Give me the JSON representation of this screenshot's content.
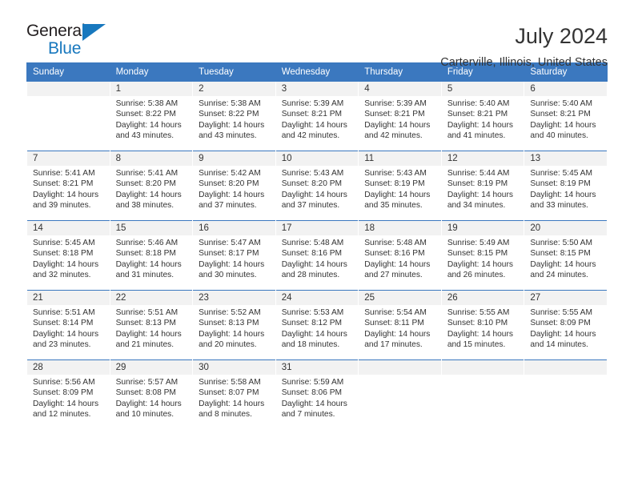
{
  "brand": {
    "name_part1": "General",
    "name_part2": "Blue"
  },
  "header": {
    "title": "July 2024",
    "location": "Carterville, Illinois, United States"
  },
  "weekdays": [
    "Sunday",
    "Monday",
    "Tuesday",
    "Wednesday",
    "Thursday",
    "Friday",
    "Saturday"
  ],
  "colors": {
    "header_blue": "#3b78bf",
    "brand_blue": "#1878be",
    "daynum_bg": "#f2f2f2",
    "text": "#333333"
  },
  "labels": {
    "sunrise_prefix": "Sunrise: ",
    "sunset_prefix": "Sunset: ",
    "daylight_prefix": "Daylight: "
  },
  "weeks": [
    [
      {
        "day": "",
        "sunrise": "",
        "sunset": "",
        "daylight_l1": "",
        "daylight_l2": "",
        "empty": true
      },
      {
        "day": "1",
        "sunrise": "Sunrise: 5:38 AM",
        "sunset": "Sunset: 8:22 PM",
        "daylight_l1": "Daylight: 14 hours",
        "daylight_l2": "and 43 minutes."
      },
      {
        "day": "2",
        "sunrise": "Sunrise: 5:38 AM",
        "sunset": "Sunset: 8:22 PM",
        "daylight_l1": "Daylight: 14 hours",
        "daylight_l2": "and 43 minutes."
      },
      {
        "day": "3",
        "sunrise": "Sunrise: 5:39 AM",
        "sunset": "Sunset: 8:21 PM",
        "daylight_l1": "Daylight: 14 hours",
        "daylight_l2": "and 42 minutes."
      },
      {
        "day": "4",
        "sunrise": "Sunrise: 5:39 AM",
        "sunset": "Sunset: 8:21 PM",
        "daylight_l1": "Daylight: 14 hours",
        "daylight_l2": "and 42 minutes."
      },
      {
        "day": "5",
        "sunrise": "Sunrise: 5:40 AM",
        "sunset": "Sunset: 8:21 PM",
        "daylight_l1": "Daylight: 14 hours",
        "daylight_l2": "and 41 minutes."
      },
      {
        "day": "6",
        "sunrise": "Sunrise: 5:40 AM",
        "sunset": "Sunset: 8:21 PM",
        "daylight_l1": "Daylight: 14 hours",
        "daylight_l2": "and 40 minutes."
      }
    ],
    [
      {
        "day": "7",
        "sunrise": "Sunrise: 5:41 AM",
        "sunset": "Sunset: 8:21 PM",
        "daylight_l1": "Daylight: 14 hours",
        "daylight_l2": "and 39 minutes."
      },
      {
        "day": "8",
        "sunrise": "Sunrise: 5:41 AM",
        "sunset": "Sunset: 8:20 PM",
        "daylight_l1": "Daylight: 14 hours",
        "daylight_l2": "and 38 minutes."
      },
      {
        "day": "9",
        "sunrise": "Sunrise: 5:42 AM",
        "sunset": "Sunset: 8:20 PM",
        "daylight_l1": "Daylight: 14 hours",
        "daylight_l2": "and 37 minutes."
      },
      {
        "day": "10",
        "sunrise": "Sunrise: 5:43 AM",
        "sunset": "Sunset: 8:20 PM",
        "daylight_l1": "Daylight: 14 hours",
        "daylight_l2": "and 37 minutes."
      },
      {
        "day": "11",
        "sunrise": "Sunrise: 5:43 AM",
        "sunset": "Sunset: 8:19 PM",
        "daylight_l1": "Daylight: 14 hours",
        "daylight_l2": "and 35 minutes."
      },
      {
        "day": "12",
        "sunrise": "Sunrise: 5:44 AM",
        "sunset": "Sunset: 8:19 PM",
        "daylight_l1": "Daylight: 14 hours",
        "daylight_l2": "and 34 minutes."
      },
      {
        "day": "13",
        "sunrise": "Sunrise: 5:45 AM",
        "sunset": "Sunset: 8:19 PM",
        "daylight_l1": "Daylight: 14 hours",
        "daylight_l2": "and 33 minutes."
      }
    ],
    [
      {
        "day": "14",
        "sunrise": "Sunrise: 5:45 AM",
        "sunset": "Sunset: 8:18 PM",
        "daylight_l1": "Daylight: 14 hours",
        "daylight_l2": "and 32 minutes."
      },
      {
        "day": "15",
        "sunrise": "Sunrise: 5:46 AM",
        "sunset": "Sunset: 8:18 PM",
        "daylight_l1": "Daylight: 14 hours",
        "daylight_l2": "and 31 minutes."
      },
      {
        "day": "16",
        "sunrise": "Sunrise: 5:47 AM",
        "sunset": "Sunset: 8:17 PM",
        "daylight_l1": "Daylight: 14 hours",
        "daylight_l2": "and 30 minutes."
      },
      {
        "day": "17",
        "sunrise": "Sunrise: 5:48 AM",
        "sunset": "Sunset: 8:16 PM",
        "daylight_l1": "Daylight: 14 hours",
        "daylight_l2": "and 28 minutes."
      },
      {
        "day": "18",
        "sunrise": "Sunrise: 5:48 AM",
        "sunset": "Sunset: 8:16 PM",
        "daylight_l1": "Daylight: 14 hours",
        "daylight_l2": "and 27 minutes."
      },
      {
        "day": "19",
        "sunrise": "Sunrise: 5:49 AM",
        "sunset": "Sunset: 8:15 PM",
        "daylight_l1": "Daylight: 14 hours",
        "daylight_l2": "and 26 minutes."
      },
      {
        "day": "20",
        "sunrise": "Sunrise: 5:50 AM",
        "sunset": "Sunset: 8:15 PM",
        "daylight_l1": "Daylight: 14 hours",
        "daylight_l2": "and 24 minutes."
      }
    ],
    [
      {
        "day": "21",
        "sunrise": "Sunrise: 5:51 AM",
        "sunset": "Sunset: 8:14 PM",
        "daylight_l1": "Daylight: 14 hours",
        "daylight_l2": "and 23 minutes."
      },
      {
        "day": "22",
        "sunrise": "Sunrise: 5:51 AM",
        "sunset": "Sunset: 8:13 PM",
        "daylight_l1": "Daylight: 14 hours",
        "daylight_l2": "and 21 minutes."
      },
      {
        "day": "23",
        "sunrise": "Sunrise: 5:52 AM",
        "sunset": "Sunset: 8:13 PM",
        "daylight_l1": "Daylight: 14 hours",
        "daylight_l2": "and 20 minutes."
      },
      {
        "day": "24",
        "sunrise": "Sunrise: 5:53 AM",
        "sunset": "Sunset: 8:12 PM",
        "daylight_l1": "Daylight: 14 hours",
        "daylight_l2": "and 18 minutes."
      },
      {
        "day": "25",
        "sunrise": "Sunrise: 5:54 AM",
        "sunset": "Sunset: 8:11 PM",
        "daylight_l1": "Daylight: 14 hours",
        "daylight_l2": "and 17 minutes."
      },
      {
        "day": "26",
        "sunrise": "Sunrise: 5:55 AM",
        "sunset": "Sunset: 8:10 PM",
        "daylight_l1": "Daylight: 14 hours",
        "daylight_l2": "and 15 minutes."
      },
      {
        "day": "27",
        "sunrise": "Sunrise: 5:55 AM",
        "sunset": "Sunset: 8:09 PM",
        "daylight_l1": "Daylight: 14 hours",
        "daylight_l2": "and 14 minutes."
      }
    ],
    [
      {
        "day": "28",
        "sunrise": "Sunrise: 5:56 AM",
        "sunset": "Sunset: 8:09 PM",
        "daylight_l1": "Daylight: 14 hours",
        "daylight_l2": "and 12 minutes."
      },
      {
        "day": "29",
        "sunrise": "Sunrise: 5:57 AM",
        "sunset": "Sunset: 8:08 PM",
        "daylight_l1": "Daylight: 14 hours",
        "daylight_l2": "and 10 minutes."
      },
      {
        "day": "30",
        "sunrise": "Sunrise: 5:58 AM",
        "sunset": "Sunset: 8:07 PM",
        "daylight_l1": "Daylight: 14 hours",
        "daylight_l2": "and 8 minutes."
      },
      {
        "day": "31",
        "sunrise": "Sunrise: 5:59 AM",
        "sunset": "Sunset: 8:06 PM",
        "daylight_l1": "Daylight: 14 hours",
        "daylight_l2": "and 7 minutes."
      },
      {
        "day": "",
        "sunrise": "",
        "sunset": "",
        "daylight_l1": "",
        "daylight_l2": "",
        "empty": true
      },
      {
        "day": "",
        "sunrise": "",
        "sunset": "",
        "daylight_l1": "",
        "daylight_l2": "",
        "empty": true
      },
      {
        "day": "",
        "sunrise": "",
        "sunset": "",
        "daylight_l1": "",
        "daylight_l2": "",
        "empty": true
      }
    ]
  ]
}
